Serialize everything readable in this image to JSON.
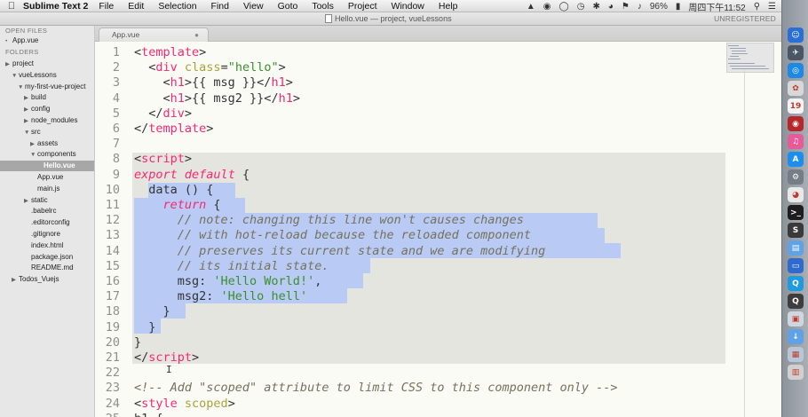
{
  "menubar": {
    "app_name": "Sublime Text 2",
    "menus": [
      "File",
      "Edit",
      "Selection",
      "Find",
      "View",
      "Goto",
      "Tools",
      "Project",
      "Window",
      "Help"
    ],
    "battery": "96%",
    "clock": "周四下午11:52"
  },
  "window": {
    "title": "Hello.vue — project, vueLessons",
    "registration": "UNREGISTERED"
  },
  "sidebar": {
    "open_files_header": "OPEN FILES",
    "open_files": [
      "App.vue"
    ],
    "folders_header": "FOLDERS",
    "tree": [
      {
        "label": "project",
        "arrow": "▶",
        "selected": false
      },
      {
        "label": "vueLessons",
        "arrow": "▼",
        "selected": false
      },
      {
        "label": "my-first-vue-project",
        "arrow": "▼",
        "selected": false
      },
      {
        "label": "build",
        "arrow": "▶",
        "selected": false
      },
      {
        "label": "config",
        "arrow": "▶",
        "selected": false
      },
      {
        "label": "node_modules",
        "arrow": "▶",
        "selected": false
      },
      {
        "label": "src",
        "arrow": "▼",
        "selected": false
      },
      {
        "label": "assets",
        "arrow": "▶",
        "selected": false
      },
      {
        "label": "components",
        "arrow": "▼",
        "selected": false
      },
      {
        "label": "Hello.vue",
        "arrow": "",
        "selected": true
      },
      {
        "label": "App.vue",
        "arrow": "",
        "selected": false
      },
      {
        "label": "main.js",
        "arrow": "",
        "selected": false
      },
      {
        "label": "static",
        "arrow": "▶",
        "selected": false
      },
      {
        "label": ".babelrc",
        "arrow": "",
        "selected": false
      },
      {
        "label": ".editorconfig",
        "arrow": "",
        "selected": false
      },
      {
        "label": ".gitignore",
        "arrow": "",
        "selected": false
      },
      {
        "label": "index.html",
        "arrow": "",
        "selected": false
      },
      {
        "label": "package.json",
        "arrow": "",
        "selected": false
      },
      {
        "label": "README.md",
        "arrow": "",
        "selected": false
      },
      {
        "label": "Todos_Vuejs",
        "arrow": "▶",
        "selected": false
      }
    ]
  },
  "tabs": [
    {
      "label": "App.vue",
      "close": "●"
    }
  ],
  "editor": {
    "lines": [
      {
        "num": "1",
        "tokens": [
          [
            "tk-punc",
            "<"
          ],
          [
            "tk-tag",
            "template"
          ],
          [
            "tk-punc",
            ">"
          ]
        ]
      },
      {
        "num": "2",
        "tokens": [
          [
            "tk-plain",
            "  <"
          ],
          [
            "tk-tag",
            "div"
          ],
          [
            "tk-plain",
            " "
          ],
          [
            "tk-attr",
            "class"
          ],
          [
            "tk-plain",
            "="
          ],
          [
            "tk-str",
            "\"hello\""
          ],
          [
            "tk-punc",
            ">"
          ]
        ]
      },
      {
        "num": "3",
        "tokens": [
          [
            "tk-plain",
            "    <"
          ],
          [
            "tk-tag",
            "h1"
          ],
          [
            "tk-plain",
            ">{{ msg }}</"
          ],
          [
            "tk-tag",
            "h1"
          ],
          [
            "tk-punc",
            ">"
          ]
        ]
      },
      {
        "num": "4",
        "tokens": [
          [
            "tk-plain",
            "    <"
          ],
          [
            "tk-tag",
            "h1"
          ],
          [
            "tk-plain",
            ">{{ msg2 }}</"
          ],
          [
            "tk-tag",
            "h1"
          ],
          [
            "tk-punc",
            ">"
          ]
        ]
      },
      {
        "num": "5",
        "tokens": [
          [
            "tk-plain",
            "  </"
          ],
          [
            "tk-tag",
            "div"
          ],
          [
            "tk-punc",
            ">"
          ]
        ]
      },
      {
        "num": "6",
        "tokens": [
          [
            "tk-plain",
            "</"
          ],
          [
            "tk-tag",
            "template"
          ],
          [
            "tk-punc",
            ">"
          ]
        ]
      },
      {
        "num": "7",
        "tokens": []
      },
      {
        "num": "8",
        "tokens": [
          [
            "tk-plain",
            "<"
          ],
          [
            "tk-tag",
            "script"
          ],
          [
            "tk-punc",
            ">"
          ]
        ]
      },
      {
        "num": "9",
        "tokens": [
          [
            "tk-kw",
            "export"
          ],
          [
            "tk-plain",
            " "
          ],
          [
            "tk-kw",
            "default"
          ],
          [
            "tk-plain",
            " {"
          ]
        ]
      },
      {
        "num": "10",
        "tokens": [
          [
            "tk-plain",
            "  data () {"
          ]
        ]
      },
      {
        "num": "11",
        "tokens": [
          [
            "tk-plain",
            "    "
          ],
          [
            "tk-kw",
            "return"
          ],
          [
            "tk-plain",
            " {"
          ]
        ]
      },
      {
        "num": "12",
        "tokens": [
          [
            "tk-cmt",
            "      // note: changing this line won't causes changes"
          ]
        ]
      },
      {
        "num": "13",
        "tokens": [
          [
            "tk-cmt",
            "      // with hot-reload because the reloaded component"
          ]
        ]
      },
      {
        "num": "14",
        "tokens": [
          [
            "tk-cmt",
            "      // preserves its current state and we are modifying"
          ]
        ]
      },
      {
        "num": "15",
        "tokens": [
          [
            "tk-cmt",
            "      // its initial state."
          ]
        ]
      },
      {
        "num": "16",
        "tokens": [
          [
            "tk-plain",
            "      msg: "
          ],
          [
            "tk-str",
            "'Hello World!'"
          ],
          [
            "tk-plain",
            ","
          ]
        ]
      },
      {
        "num": "17",
        "tokens": [
          [
            "tk-plain",
            "      msg2: "
          ],
          [
            "tk-str",
            "'Hello hell'"
          ]
        ]
      },
      {
        "num": "18",
        "tokens": [
          [
            "tk-plain",
            "    }"
          ]
        ]
      },
      {
        "num": "19",
        "tokens": [
          [
            "tk-plain",
            "  }"
          ]
        ]
      },
      {
        "num": "20",
        "tokens": [
          [
            "tk-plain",
            "}"
          ]
        ]
      },
      {
        "num": "21",
        "tokens": [
          [
            "tk-plain",
            "</"
          ],
          [
            "tk-tag",
            "script"
          ],
          [
            "tk-punc",
            ">"
          ]
        ]
      },
      {
        "num": "22",
        "tokens": []
      },
      {
        "num": "23",
        "tokens": [
          [
            "tk-cmt",
            "<!-- Add \"scoped\" attribute to limit CSS to this component only -->"
          ]
        ]
      },
      {
        "num": "24",
        "tokens": [
          [
            "tk-plain",
            "<"
          ],
          [
            "tk-tag",
            "style"
          ],
          [
            "tk-plain",
            " "
          ],
          [
            "tk-attr",
            "scoped"
          ],
          [
            "tk-punc",
            ">"
          ]
        ]
      },
      {
        "num": "25",
        "tokens": [
          [
            "tk-plain",
            "h1 {"
          ]
        ]
      }
    ]
  },
  "dock": {
    "apps": [
      {
        "name": "finder-icon",
        "color": "#2a6fd6",
        "glyph": "☺"
      },
      {
        "name": "launchpad-icon",
        "color": "#4a5566",
        "glyph": "✈"
      },
      {
        "name": "safari-icon",
        "color": "#1e88e5",
        "glyph": "◎"
      },
      {
        "name": "photos-icon",
        "color": "#d8d8d8",
        "glyph": "✿"
      },
      {
        "name": "calendar-icon",
        "color": "#f4f4f4",
        "glyph": "19"
      },
      {
        "name": "photo-booth-icon",
        "color": "#b6262b",
        "glyph": "◉"
      },
      {
        "name": "itunes-icon",
        "color": "#e85a9a",
        "glyph": "♫"
      },
      {
        "name": "app-store-icon",
        "color": "#1c8ef0",
        "glyph": "A"
      },
      {
        "name": "system-preferences-icon",
        "color": "#777d86",
        "glyph": "⚙"
      },
      {
        "name": "chrome-icon",
        "color": "#e9e9e9",
        "glyph": "◕"
      },
      {
        "name": "terminal-icon",
        "color": "#1d1d1d",
        "glyph": ">_"
      },
      {
        "name": "sublime-text-icon",
        "color": "#3a3a3a",
        "glyph": "S"
      },
      {
        "name": "documents-folder-icon",
        "color": "#5fa2e6",
        "glyph": "▤"
      },
      {
        "name": "keynote-icon",
        "color": "#2f6bcd",
        "glyph": "▭"
      },
      {
        "name": "qq-icon",
        "color": "#1e9ae0",
        "glyph": "Q"
      },
      {
        "name": "quicktime-icon",
        "color": "#3d3d3d",
        "glyph": "Q"
      },
      {
        "name": "preview-icon",
        "color": "#cfd6df",
        "glyph": "▣"
      },
      {
        "name": "downloads-folder-icon",
        "color": "#5fa2e6",
        "glyph": "↓"
      },
      {
        "name": "screenshot-thumbnail-icon",
        "color": "#b8c6d8",
        "glyph": "▦"
      },
      {
        "name": "trash-icon",
        "color": "#d0d0d0",
        "glyph": "▥"
      }
    ]
  }
}
